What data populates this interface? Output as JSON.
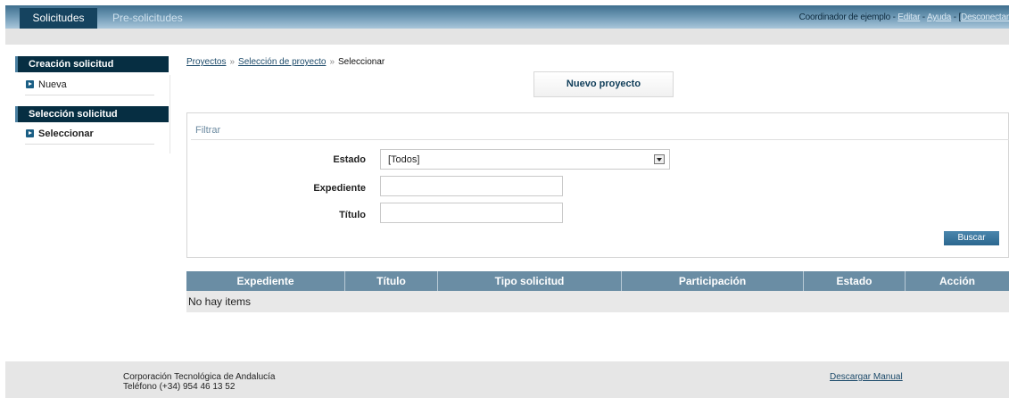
{
  "topnav": {
    "tabs": [
      {
        "label": "Solicitudes",
        "active": true
      },
      {
        "label": "Pre-solicitudes",
        "active": false
      }
    ],
    "user": "Coordinador de ejemplo",
    "sep": " - ",
    "edit_label": "Editar",
    "help_label": "Ayuda",
    "logout_bracket": "[",
    "logout_label": "Desconectar"
  },
  "sidebar": {
    "sections": [
      {
        "title": "Creación solicitud",
        "items": [
          {
            "label": "Nueva"
          }
        ]
      },
      {
        "title": "Selección solicitud",
        "items": [
          {
            "label": "Seleccionar"
          }
        ]
      }
    ]
  },
  "breadcrumb": {
    "items": [
      "Proyectos",
      "Selección de proyecto"
    ],
    "separator": "»",
    "current": "Seleccionar"
  },
  "new_project_label": "Nuevo proyecto",
  "filter": {
    "title": "Filtrar",
    "estado_label": "Estado",
    "estado_value": "[Todos]",
    "expediente_label": "Expediente",
    "expediente_value": "",
    "titulo_label": "Título",
    "titulo_value": "",
    "search_label": "Buscar"
  },
  "table": {
    "columns": [
      "Expediente",
      "Título",
      "Tipo solicitud",
      "Participación",
      "Estado",
      "Acción"
    ],
    "empty_text": "No hay items"
  },
  "footer": {
    "org": "Corporación Tecnológica de Andalucía",
    "phone": "Teléfono (+34) 954 46 13 52",
    "manual_label": "Descargar Manual"
  },
  "colors": {
    "topbar": "#3f6f8e",
    "active_tab": "#15435f",
    "sidebar_header": "#062e42",
    "table_header": "#6a8da4",
    "search_button": "#2c678f"
  }
}
